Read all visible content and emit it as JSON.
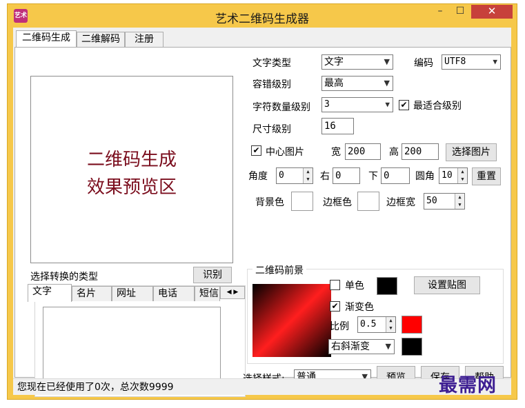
{
  "window": {
    "title": "艺术二维码生成器",
    "icon_label": "艺术",
    "min_glyph": "–",
    "max_glyph": "☐",
    "close_glyph": "✕"
  },
  "tabs": [
    {
      "label": "二维码生成",
      "active": true
    },
    {
      "label": "二维解码",
      "active": false
    },
    {
      "label": "注册",
      "active": false
    }
  ],
  "preview": {
    "line1": "二维码生成",
    "line2": "效果预览区"
  },
  "settings": {
    "text_type_label": "文字类型",
    "text_type_value": "文字",
    "encoding_label": "编码",
    "encoding_value": "UTF8",
    "ecc_label": "容错级别",
    "ecc_value": "最高",
    "charcount_label": "字符数量级别",
    "charcount_value": "3",
    "best_fit_label": "最适合级别",
    "best_fit_checked": true,
    "size_label": "尺寸级别",
    "size_value": "16",
    "center_image_label": "中心图片",
    "center_image_checked": true,
    "width_label": "宽",
    "width_value": "200",
    "height_label": "高",
    "height_value": "200",
    "select_image_button": "选择图片",
    "angle_label": "角度",
    "angle_value": "0",
    "right_label": "右",
    "right_value": "0",
    "down_label": "下",
    "down_value": "0",
    "corner_label": "圆角",
    "corner_value": "10",
    "reset_button": "重置",
    "bg_color_label": "背景色",
    "bg_color": "#ffffff",
    "border_color_label": "边框色",
    "border_color": "#ffffff",
    "border_width_label": "边框宽",
    "border_width_value": "50"
  },
  "foreground": {
    "group_title": "二维码前景",
    "single_color_label": "单色",
    "single_color_checked": false,
    "single_color": "#000000",
    "set_texture_button": "设置贴图",
    "gradient_label": "渐变色",
    "gradient_checked": true,
    "ratio_label": "比例",
    "ratio_value": "0.5",
    "ratio_color": "#ff0000",
    "gradient_mode_value": "右斜渐变",
    "gradient_mode_color": "#000000"
  },
  "convert_type": {
    "label": "选择转换的类型",
    "identify_button": "识别",
    "tabs": [
      "文字",
      "名片",
      "网址",
      "电话",
      "短信"
    ],
    "active_tab": "文字",
    "text_value": ""
  },
  "bottom": {
    "style_label": "选择样式:",
    "style_value": "普通",
    "preview_button": "预览",
    "save_button": "保存",
    "help_button": "帮助"
  },
  "status": {
    "text": "您现在已经使用了0次，总次数9999"
  },
  "watermark": "最需网"
}
